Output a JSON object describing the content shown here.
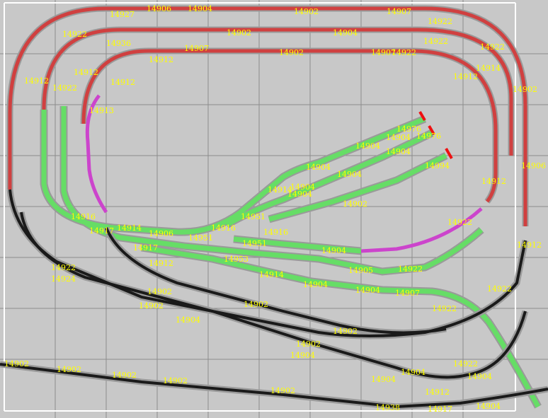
{
  "diagram": {
    "colors": {
      "background": "#c8c8c8",
      "grid": "#8c8c8c",
      "frame": "#ffffff",
      "track_red": "#d04040",
      "track_green": "#66dd66",
      "track_black": "#1a1a1a",
      "track_magenta": "#cc44cc",
      "label": "#ffff00"
    },
    "labels": [
      "14927",
      "14906",
      "14904",
      "14902",
      "14907",
      "14922",
      "14902",
      "14904",
      "14922",
      "14936",
      "14907",
      "14902",
      "14907",
      "14912",
      "14922",
      "14922",
      "14912",
      "14922",
      "14912",
      "14922",
      "14914",
      "14912",
      "14913",
      "14912",
      "14904",
      "14904",
      "14904",
      "14976",
      "14904",
      "14904",
      "14904",
      "14976",
      "14994",
      "14914",
      "14904",
      "14902",
      "14916",
      "14917",
      "14914",
      "14906",
      "14951",
      "14916",
      "14951",
      "14916",
      "14951",
      "14904",
      "14922",
      "14912",
      "14917",
      "14953",
      "14912",
      "14914",
      "14904",
      "14904",
      "14907",
      "14905",
      "14922",
      "14922",
      "14924",
      "14902",
      "14902",
      "14904",
      "14902",
      "14902",
      "14902",
      "14902",
      "14902",
      "14902",
      "14902",
      "14902",
      "14904",
      "14904",
      "14904",
      "14938",
      "14917",
      "14904",
      "14912",
      "14922",
      "14922",
      "14922",
      "14902",
      "14906",
      "14912",
      "14904"
    ]
  }
}
